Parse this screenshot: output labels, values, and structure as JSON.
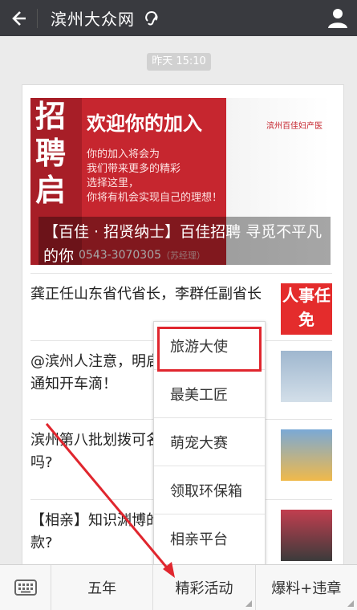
{
  "header": {
    "title": "滨州大众网",
    "back_icon": "back-arrow-icon",
    "listen_icon": "ear-icon",
    "profile_icon": "user-icon"
  },
  "timestamp": "昨天 15:10",
  "banner": {
    "left_text": "招聘启",
    "welcome": "欢迎你的加入",
    "lines": [
      "你的加入将会为",
      "我们带来更多的精彩",
      "选择这里，",
      "你将有机会实现自己的理想！"
    ],
    "logo_text": "滨州百佳妇产医",
    "phone": "0543-3070305",
    "contact": "（苏经理）",
    "caption": "【百佳 · 招贤纳士】百佳招聘 寻觅不平凡的你"
  },
  "articles": [
    {
      "title": "龚正任山东省代省长，李群任副省长",
      "thumb_text": "人事任免"
    },
    {
      "title": "@滨州人注意，明启用90多个违法抓通知开车滴！"
    },
    {
      "title": "滨州第八批划拨可名单公布，共24个吗?"
    },
    {
      "title": "【相亲】知识渊博的大长腿的小鲜肉款?"
    }
  ],
  "popup_menu": [
    "旅游大使",
    "最美工匠",
    "萌宠大赛",
    "领取环保箱",
    "相亲平台"
  ],
  "bottom_tabs": [
    "五年",
    "精彩活动",
    "爆料+违章"
  ],
  "keyboard_icon": "keyboard-icon",
  "accent_color": "#e0262e"
}
